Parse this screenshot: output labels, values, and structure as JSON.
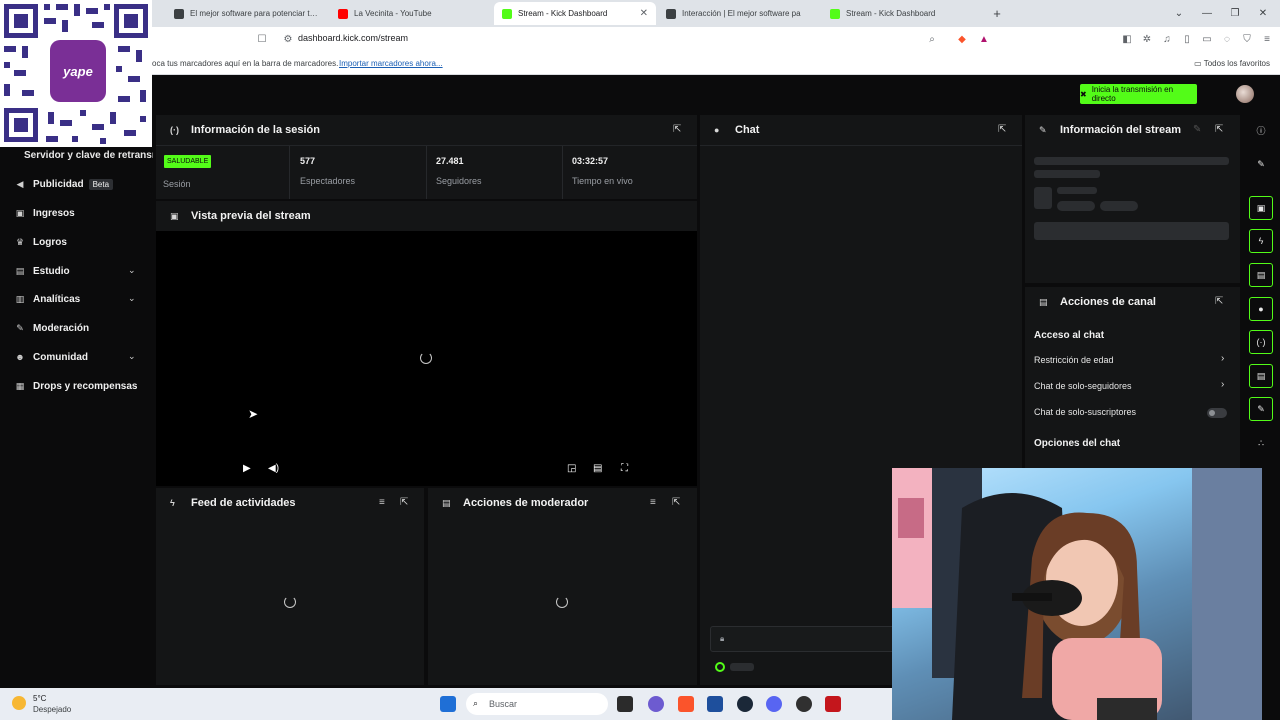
{
  "browser": {
    "tabs": [
      {
        "title": "El mejor software para potenciar tu s",
        "color": "#3c4043"
      },
      {
        "title": "La Vecinita - YouTube",
        "color": "#ff0000"
      },
      {
        "title": "Stream - Kick Dashboard",
        "color": "#53fc18"
      },
      {
        "title": "Interacción | El mejor software pa",
        "color": "#3c4043"
      },
      {
        "title": "Stream - Kick Dashboard",
        "color": "#53fc18"
      }
    ],
    "new_tab_symbol": "+",
    "url": "dashboard.kick.com/stream",
    "bookmarks_hint": "oca tus marcadores aquí en la barra de marcadores.",
    "import_link": "Importar marcadores ahora...",
    "all_favorites": "Todos los favoritos"
  },
  "header": {
    "go_live_label": "Inicia la transmisión en directo",
    "accent": "#53fc18"
  },
  "sidebar": {
    "qr_logo": "yape",
    "section_title": "Servidor y clave de retransm",
    "items": [
      {
        "label": "Publicidad",
        "badge": "Beta",
        "icon": "megaphone-icon"
      },
      {
        "label": "Ingresos",
        "icon": "dollar-icon"
      },
      {
        "label": "Logros",
        "icon": "trophy-icon"
      },
      {
        "label": "Estudio",
        "icon": "studio-icon",
        "expandable": true
      },
      {
        "label": "Analíticas",
        "icon": "chart-icon",
        "expandable": true
      },
      {
        "label": "Moderación",
        "icon": "wrench-icon"
      },
      {
        "label": "Comunidad",
        "icon": "users-icon",
        "expandable": true
      },
      {
        "label": "Drops y recompensas",
        "icon": "gift-icon"
      }
    ]
  },
  "session": {
    "title": "Información de la sesión",
    "health_badge": "SALUDABLE",
    "health_label": "Sesión",
    "stats": [
      {
        "value": "577",
        "label": "Espectadores"
      },
      {
        "value": "27.481",
        "label": "Seguidores"
      },
      {
        "value": "03:32:57",
        "label": "Tiempo en vivo"
      }
    ]
  },
  "preview": {
    "title": "Vista previa del stream"
  },
  "feed": {
    "title": "Feed de actividades"
  },
  "mod": {
    "title": "Acciones de moderador"
  },
  "chat": {
    "title": "Chat"
  },
  "stream_info": {
    "title": "Información del stream"
  },
  "channel_actions": {
    "title": "Acciones de canal",
    "section1": "Acceso al chat",
    "rows": [
      {
        "label": "Restricción de edad",
        "type": "arrow"
      },
      {
        "label": "Chat de solo-seguidores",
        "type": "arrow"
      },
      {
        "label": "Chat de solo-suscriptores",
        "type": "toggle"
      }
    ],
    "section2": "Opciones del chat"
  },
  "taskbar": {
    "temp": "5°C",
    "weather": "Despejado",
    "search": "Buscar"
  }
}
